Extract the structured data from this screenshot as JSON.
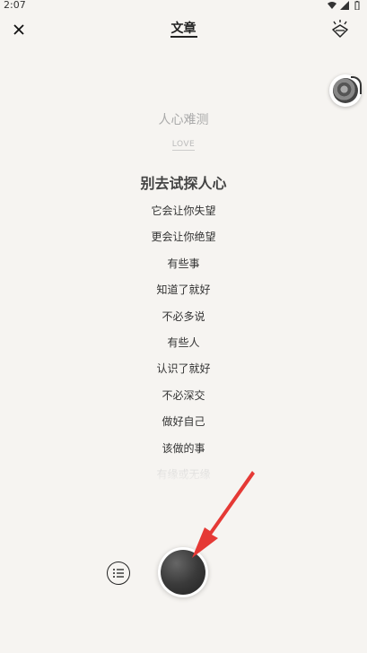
{
  "status_bar": {
    "time": "2:07"
  },
  "header": {
    "title": "文章"
  },
  "article": {
    "title": "人心难测",
    "author": "LOVE",
    "heading": "别去试探人心",
    "lines": [
      "它会让你失望",
      "更会让你绝望",
      "有些事",
      "知道了就好",
      "不必多说",
      "有些人",
      "认识了就好",
      "不必深交",
      "做好自己",
      "该做的事",
      "有缘或无缘"
    ]
  },
  "icons": {
    "close": "close-icon",
    "lamp": "lamp-icon",
    "music": "music-disc-icon",
    "toc": "list-icon",
    "record": "record-icon"
  },
  "colors": {
    "background": "#f6f4f1",
    "arrow": "#e53935",
    "text": "#333333",
    "muted": "#aaaaaa"
  }
}
